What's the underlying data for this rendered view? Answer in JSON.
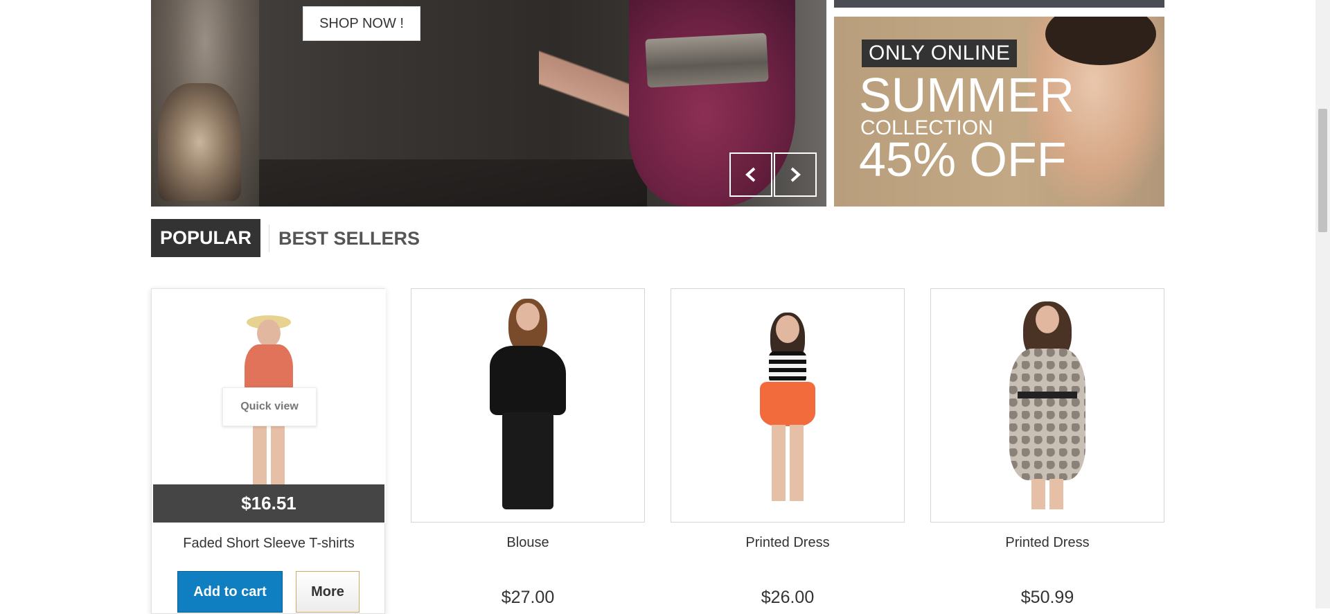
{
  "hero": {
    "shop_now_label": "SHOP NOW !",
    "prev_icon": "chevron-left-icon",
    "next_icon": "chevron-right-icon"
  },
  "banner": {
    "tag": "ONLY ONLINE",
    "line1": "SUMMER",
    "line2": "COLLECTION",
    "line3": "45% OFF"
  },
  "tabs": [
    {
      "label": "POPULAR",
      "active": true
    },
    {
      "label": "BEST SELLERS",
      "active": false
    }
  ],
  "products": [
    {
      "name": "Faded Short Sleeve T-shirts",
      "price": "$16.51",
      "quick_view": "Quick view",
      "add_to_cart": "Add to cart",
      "more": "More"
    },
    {
      "name": "Blouse",
      "price": "$27.00"
    },
    {
      "name": "Printed Dress",
      "price": "$26.00"
    },
    {
      "name": "Printed Dress",
      "price": "$50.99"
    }
  ],
  "colors": {
    "accent_blue": "#0f7fc2",
    "tab_active_bg": "#333333",
    "price_bar_bg": "#454545"
  }
}
